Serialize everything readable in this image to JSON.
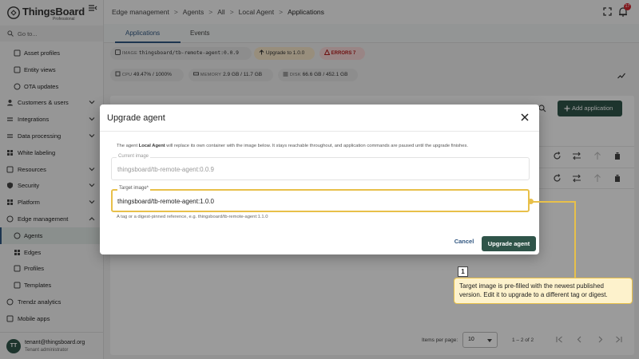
{
  "app": {
    "brand": "ThingsBoard",
    "edition": "Professional"
  },
  "sidebar": {
    "goto_placeholder": "Go to...",
    "items": [
      {
        "label": "Asset profiles",
        "icon": "asset-profile-icon",
        "level": "sub"
      },
      {
        "label": "Entity views",
        "icon": "entity-view-icon",
        "level": "sub"
      },
      {
        "label": "OTA updates",
        "icon": "ota-icon",
        "level": "sub"
      },
      {
        "label": "Customers & users",
        "icon": "customers-icon",
        "level": "top",
        "chevron": "down"
      },
      {
        "label": "Integrations",
        "icon": "integrations-icon",
        "level": "top",
        "chevron": "down"
      },
      {
        "label": "Data processing",
        "icon": "data-processing-icon",
        "level": "top",
        "chevron": "down"
      },
      {
        "label": "White labeling",
        "icon": "white-labeling-icon",
        "level": "top"
      },
      {
        "label": "Resources",
        "icon": "resources-icon",
        "level": "top",
        "chevron": "down"
      },
      {
        "label": "Security",
        "icon": "security-icon",
        "level": "top",
        "chevron": "down"
      },
      {
        "label": "Platform",
        "icon": "platform-icon",
        "level": "top",
        "chevron": "down"
      },
      {
        "label": "Edge management",
        "icon": "edge-management-icon",
        "level": "top",
        "chevron": "up"
      },
      {
        "label": "Agents",
        "icon": "agents-icon",
        "level": "sub",
        "active": true
      },
      {
        "label": "Edges",
        "icon": "edges-icon",
        "level": "sub"
      },
      {
        "label": "Profiles",
        "icon": "profiles-icon",
        "level": "sub"
      },
      {
        "label": "Templates",
        "icon": "templates-icon",
        "level": "sub"
      },
      {
        "label": "Trendz analytics",
        "icon": "trendz-icon",
        "level": "top"
      },
      {
        "label": "Mobile apps",
        "icon": "mobile-icon",
        "level": "top"
      }
    ],
    "user": {
      "initials": "TT",
      "email": "tenant@thingsboard.org",
      "role": "Tenant administrator"
    }
  },
  "header": {
    "breadcrumbs": [
      "Edge management",
      "Agents",
      "All",
      "Local Agent",
      "Applications"
    ],
    "notification_count": "17"
  },
  "tabs": [
    "Applications",
    "Events"
  ],
  "status": {
    "image_key": "IMAGE",
    "image_value": "thingsboard/tb-remote-agent:0.0.9",
    "upgrade_label": "Upgrade to 1.0.0",
    "errors_label": "ERRORS",
    "errors_count": "7",
    "cpu_key": "CPU",
    "cpu_value": "49.47% / 1000%",
    "memory_key": "MEMORY",
    "memory_value": "2.9 GB / 11.7 GB",
    "disk_key": "DISK",
    "disk_value": "66.6 GB / 452.1 GB"
  },
  "background": {
    "add_application": "Add application",
    "items_per_page_label": "Items per page:",
    "items_per_page_value": "10",
    "range_label": "1 – 2 of 2"
  },
  "dialog": {
    "title": "Upgrade agent",
    "desc_prefix": "The agent ",
    "desc_agent": "Local Agent",
    "desc_suffix": " will replace its own container with the image below. It stays reachable throughout, and application commands are paused until the upgrade finishes.",
    "current_label": "Current image",
    "current_value": "thingsboard/tb-remote-agent:0.0.9",
    "target_label": "Target image*",
    "target_value": "thingsboard/tb-remote-agent:1.0.0",
    "hint": "A tag or a digest-pinned reference, e.g. thingsboard/tb-remote-agent:1.1.0",
    "cancel": "Cancel",
    "confirm": "Upgrade agent"
  },
  "callout": {
    "number": "1",
    "text": "Target image is pre-filled with the newest published version. Edit it to upgrade to a different tag or digest."
  },
  "colors": {
    "primary": "#305680",
    "accent_button": "#2f5449",
    "highlight": "#e8c04a",
    "error": "#d12730"
  }
}
